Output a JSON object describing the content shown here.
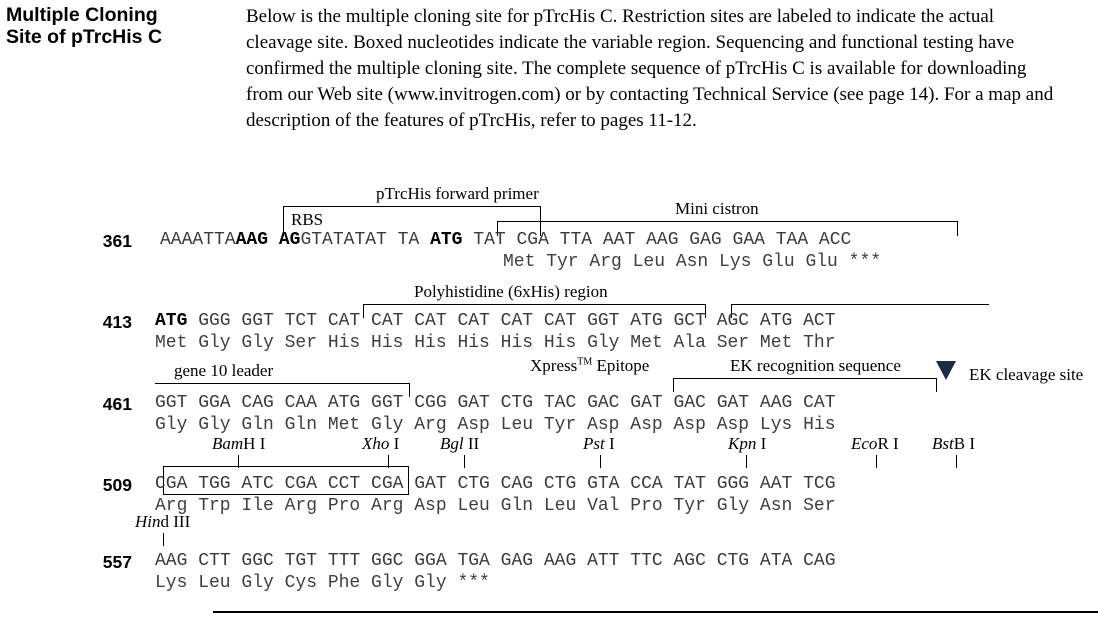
{
  "header": {
    "title_line1": "Multiple Cloning",
    "title_line2": "Site of pTrcHis C",
    "intro": "Below is the multiple cloning site for pTrcHis C. Restriction sites are labeled to indicate the actual cleavage site. Boxed nucleotides indicate the variable region. Sequencing and functional testing have confirmed the multiple cloning site. The complete sequence of pTrcHis C is available for downloading from our Web site (www.invitrogen.com) or by contacting Technical Service (see page 14). For a map and description of the features of pTrcHis, refer to pages 11-12."
  },
  "colors": {
    "text": "#000000",
    "sequence": "#3a3a3a",
    "triangle": "#20294a"
  },
  "sequence_rows": [
    {
      "number": "361",
      "nucleotides": "AAAATTAAAG AGGTATATAT TA ATG TAT CGA TTA AAT AAG GAG GAA TAA ACC",
      "nucleotides_bold_segments": [
        "AAG AG",
        "ATG"
      ],
      "amino_acids": "Met Tyr Arg Leu Asn Lys Glu Glu ***",
      "nt_plain_prefix": "AAAATTA",
      "nt_bold_1": "AAG AG",
      "nt_mid": "GTATATAT TA ",
      "nt_bold_2": "ATG",
      "nt_tail": " TAT CGA TTA AAT AAG GAG GAA TAA ACC"
    },
    {
      "number": "413",
      "nt_bold_1": "ATG",
      "nt_tail": " GGG GGT TCT CAT CAT CAT CAT CAT CAT GGT ATG GCT AGC ATG ACT",
      "amino_acids": "Met Gly Gly Ser His His His His His His Gly Met Ala Ser Met Thr"
    },
    {
      "number": "461",
      "nt_tail": "GGT GGA CAG CAA ATG GGT CGG GAT CTG TAC GAC GAT GAC GAT AAG CAT",
      "amino_acids": "Gly Gly Gln Gln Met Gly Arg Asp Leu Tyr Asp Asp Asp Asp Lys His"
    },
    {
      "number": "509",
      "nt_tail": "CGA TGG ATC CGA CCT CGA GAT CTG CAG CTG GTA CCA TAT GGG AAT TCG",
      "amino_acids": "Arg Trp Ile Arg Pro Arg Asp Leu Gln Leu Val Pro Tyr Gly Asn Ser"
    },
    {
      "number": "557",
      "nt_tail": "AAG CTT GGC TGT TTT GGC GGA TGA GAG AAG ATT TTC AGC CTG ATA CAG",
      "amino_acids": "Lys Leu Gly Cys Phe Gly Gly *** "
    }
  ],
  "feature_labels": {
    "forward_primer": "pTrcHis forward primer",
    "rbs": "RBS",
    "mini_cistron": "Mini cistron",
    "polyhistidine": "Polyhistidine (6xHis) region",
    "gene10_leader": "gene 10 leader",
    "xpress_epitope_pre": "Xpress",
    "xpress_epitope_tm": "TM",
    "xpress_epitope_post": " Epitope",
    "ek_recognition": "EK recognition sequence",
    "ek_cleavage": "EK cleavage site"
  },
  "restriction_sites": [
    {
      "italic": "Bam",
      "roman": "H I"
    },
    {
      "italic": "Xho",
      "roman": " I"
    },
    {
      "italic": "Bgl",
      "roman": " II"
    },
    {
      "italic": "Pst",
      "roman": " I"
    },
    {
      "italic": "Kpn",
      "roman": " I"
    },
    {
      "italic": "Eco",
      "roman": "R I"
    },
    {
      "italic": "Bst",
      "roman": "B I"
    },
    {
      "italic": "Hin",
      "roman": "d III"
    }
  ]
}
